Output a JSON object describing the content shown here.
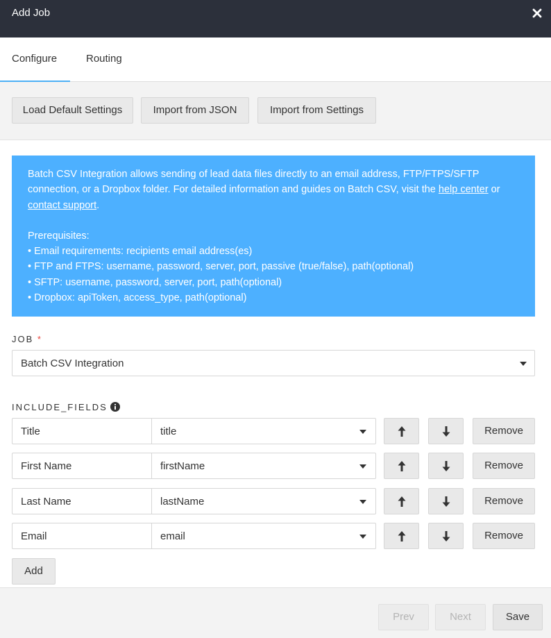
{
  "header": {
    "title": "Add Job"
  },
  "tabs": [
    {
      "label": "Configure",
      "active": true
    },
    {
      "label": "Routing",
      "active": false
    }
  ],
  "toolbar": {
    "load_default": "Load Default Settings",
    "import_json": "Import from JSON",
    "import_settings": "Import from Settings"
  },
  "info": {
    "intro_1": "Batch CSV Integration allows sending of lead data files directly to an email address, FTP/FTPS/SFTP connection, or a Dropbox folder. For detailed information and guides on Batch CSV, visit the ",
    "help_link": "help center",
    "intro_2": " or ",
    "support_link": "contact support",
    "intro_3": ".",
    "prereq_title": "Prerequisites:",
    "prereqs": [
      "• Email requirements: recipients email address(es)",
      "• FTP and FTPS: username, password, server, port, passive (true/false), path(optional)",
      "• SFTP: username, password, server, port, path(optional)",
      "• Dropbox: apiToken, access_type, path(optional)"
    ]
  },
  "job": {
    "label": "JOB",
    "required_mark": "*",
    "selected": "Batch CSV Integration"
  },
  "include_fields": {
    "label": "INCLUDE_FIELDS",
    "rows": [
      {
        "label": "Title",
        "value": "title"
      },
      {
        "label": "First Name",
        "value": "firstName"
      },
      {
        "label": "Last Name",
        "value": "lastName"
      },
      {
        "label": "Email",
        "value": "email"
      }
    ],
    "remove_label": "Remove",
    "add_label": "Add"
  },
  "footer": {
    "prev": "Prev",
    "next": "Next",
    "save": "Save"
  },
  "colors": {
    "header_bg": "#2c303b",
    "accent": "#4db0f5",
    "info_bg": "#4db0ff",
    "required": "#e8453c"
  }
}
